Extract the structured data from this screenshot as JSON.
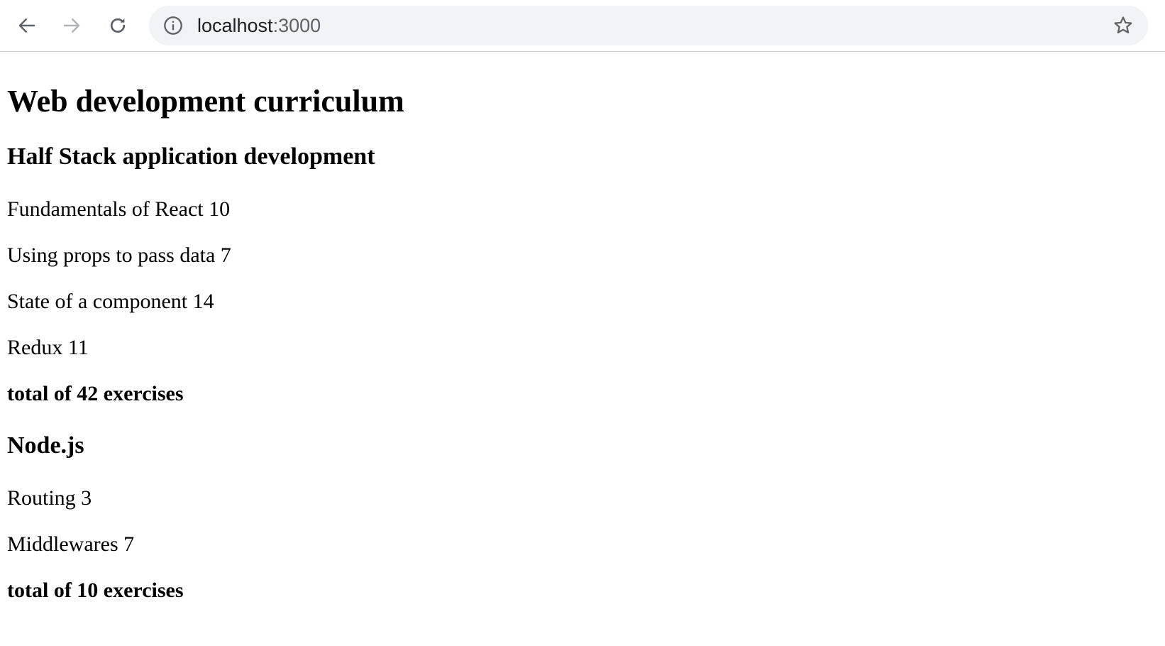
{
  "browser": {
    "url_host": "localhost",
    "url_port": ":3000",
    "icons": {
      "back": "arrow-left-icon",
      "forward": "arrow-right-icon",
      "reload": "reload-icon",
      "info": "info-icon",
      "bookmark": "star-icon"
    }
  },
  "page": {
    "title": "Web development curriculum",
    "courses": [
      {
        "name": "Half Stack application development",
        "parts": [
          {
            "text": "Fundamentals of React 10"
          },
          {
            "text": "Using props to pass data 7"
          },
          {
            "text": "State of a component 14"
          },
          {
            "text": "Redux 11"
          }
        ],
        "total": "total of 42 exercises"
      },
      {
        "name": "Node.js",
        "parts": [
          {
            "text": "Routing 3"
          },
          {
            "text": "Middlewares 7"
          }
        ],
        "total": "total of 10 exercises"
      }
    ]
  }
}
